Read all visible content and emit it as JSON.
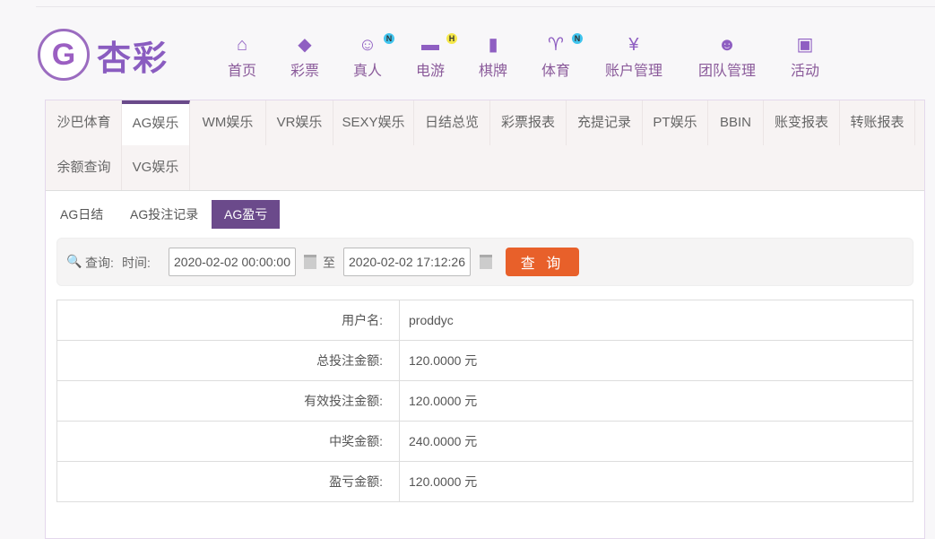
{
  "logo": {
    "text": "杏彩"
  },
  "nav": [
    {
      "label": "首页",
      "icon": "home-icon",
      "glyph": "⌂",
      "badge": ""
    },
    {
      "label": "彩票",
      "icon": "ticket-icon",
      "glyph": "◆",
      "badge": ""
    },
    {
      "label": "真人",
      "icon": "live-dealer-icon",
      "glyph": "☺",
      "badge": "N"
    },
    {
      "label": "电游",
      "icon": "gamepad-icon",
      "glyph": "▬",
      "badge": "H"
    },
    {
      "label": "棋牌",
      "icon": "cards-icon",
      "glyph": "▮",
      "badge": ""
    },
    {
      "label": "体育",
      "icon": "trophy-icon",
      "glyph": "♈",
      "badge": "N"
    },
    {
      "label": "账户管理",
      "icon": "yen-coin-icon",
      "glyph": "¥",
      "badge": ""
    },
    {
      "label": "团队管理",
      "icon": "team-icon",
      "glyph": "☻",
      "badge": ""
    },
    {
      "label": "活动",
      "icon": "gift-icon",
      "glyph": "▣",
      "badge": ""
    }
  ],
  "tabs": [
    "沙巴体育",
    "AG娱乐",
    "WM娱乐",
    "VR娱乐",
    "SEXY娱乐",
    "日结总览",
    "彩票报表",
    "充提记录",
    "PT娱乐",
    "BBIN",
    "账变报表",
    "转账报表",
    "余额查询",
    "VG娱乐"
  ],
  "active_tab": "AG娱乐",
  "subtabs": [
    "AG日结",
    "AG投注记录",
    "AG盈亏"
  ],
  "active_subtab": "AG盈亏",
  "query": {
    "label": "查询:",
    "time_label": "时间:",
    "start": "2020-02-02 00:00:00",
    "to": "至",
    "end": "2020-02-02 17:12:26",
    "button": "查 询"
  },
  "rows": [
    {
      "label": "用户名:",
      "value": "proddyc"
    },
    {
      "label": "总投注金额:",
      "value": "120.0000 元"
    },
    {
      "label": "有效投注金额:",
      "value": "120.0000 元"
    },
    {
      "label": "中奖金额:",
      "value": "240.0000 元"
    },
    {
      "label": "盈亏金额:",
      "value": "120.0000 元"
    }
  ],
  "colors": {
    "accent": "#6b4a8b",
    "button": "#e8602a",
    "badge_n": "#3fc4ee",
    "badge_h": "#f5e84a"
  }
}
